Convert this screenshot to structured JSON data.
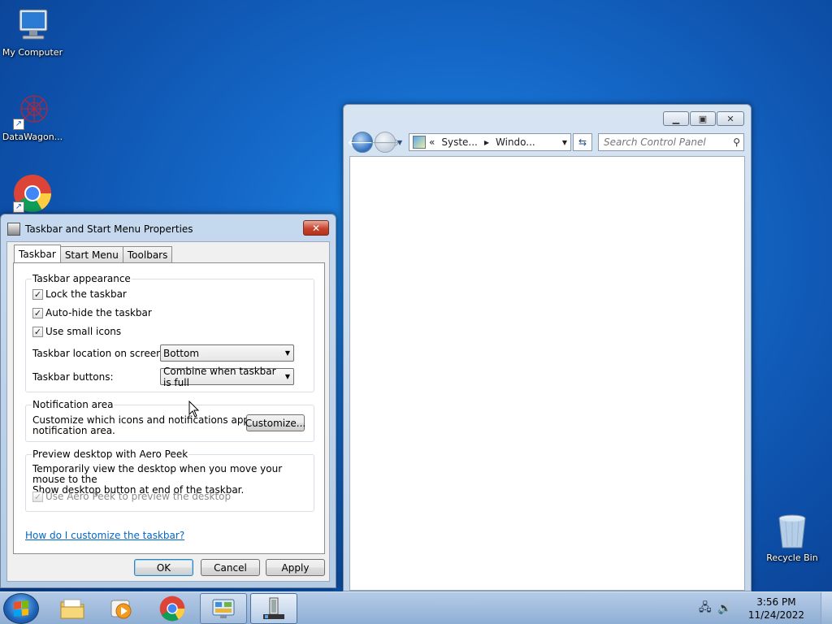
{
  "desktop": {
    "icons": [
      {
        "label": "My Computer"
      },
      {
        "label": "DataWagon..."
      },
      {
        "label": ""
      },
      {
        "label": "Recycle Bin"
      }
    ]
  },
  "explorer": {
    "breadcrumb": {
      "prefix": "«",
      "items": [
        "Syste...",
        "Windo..."
      ]
    },
    "search_placeholder": "Search Control Panel"
  },
  "dialog": {
    "title": "Taskbar and Start Menu Properties",
    "tabs": [
      "Taskbar",
      "Start Menu",
      "Toolbars"
    ],
    "active_tab": "Taskbar",
    "appearance": {
      "title": "Taskbar appearance",
      "lock_taskbar": {
        "label": "Lock the taskbar",
        "checked": true
      },
      "auto_hide": {
        "label": "Auto-hide the taskbar",
        "checked": true
      },
      "small_icons": {
        "label": "Use small icons",
        "checked": true
      },
      "location_label": "Taskbar location on screen:",
      "location_value": "Bottom",
      "buttons_label": "Taskbar buttons:",
      "buttons_value": "Combine when taskbar is full"
    },
    "notification": {
      "title": "Notification area",
      "text_line1": "Customize which icons and notifications appear in the",
      "text_line2": "notification area.",
      "customize_label": "Customize..."
    },
    "aero_peek": {
      "title": "Preview desktop with Aero Peek",
      "text_line1": "Temporarily view the desktop when you move your mouse to the",
      "text_line2": "Show desktop button at end of the taskbar.",
      "checkbox_label": "Use Aero Peek to preview the desktop",
      "checked": true,
      "disabled": true
    },
    "help_link": "How do I customize the taskbar?",
    "buttons": {
      "ok": "OK",
      "cancel": "Cancel",
      "apply": "Apply"
    }
  },
  "taskbar": {
    "clock_time": "3:56 PM",
    "clock_date": "11/24/2022",
    "pinned": [
      "windows-explorer",
      "media-player",
      "chrome",
      "control-panel",
      "taskbar-properties"
    ]
  }
}
